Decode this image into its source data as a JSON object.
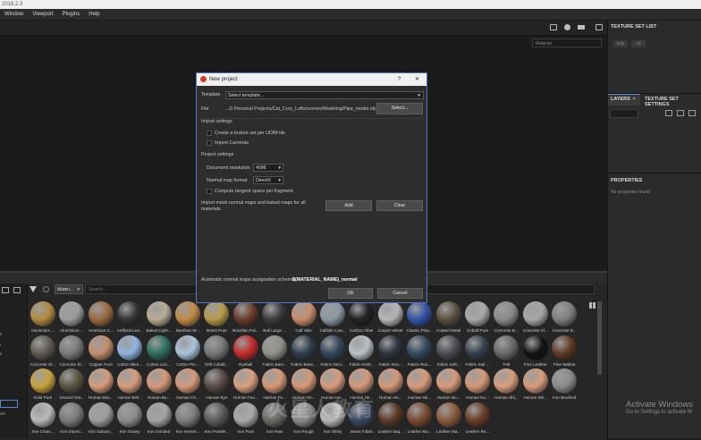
{
  "window": {
    "title": "2018.2.3"
  },
  "menu": [
    "Window",
    "Viewport",
    "Plugins",
    "Help"
  ],
  "viewport": {
    "display_channel": "Material"
  },
  "texture_set_list": {
    "title": "TEXTURE SET LIST",
    "buttons": [
      "Edit",
      "All"
    ]
  },
  "layers": {
    "tab_layers": "LAYERS",
    "tab_texture_settings": "TEXTURE SET SETTINGS",
    "close": "✕"
  },
  "properties": {
    "title": "PROPERTIES",
    "empty_text": "No properties found"
  },
  "shelf": {
    "filter_chip": "Materi...",
    "search_placeholder": "Search...",
    "side_items": [
      "s",
      "i",
      "s",
      "als"
    ],
    "materials": [
      {
        "label": "Aluminium ...",
        "color": "#b38a40"
      },
      {
        "label": "Aluminium ...",
        "color": "#9b9b9b"
      },
      {
        "label": "American C...",
        "color": "#9a6a3f"
      },
      {
        "label": "Artificial Lea...",
        "color": "#333333"
      },
      {
        "label": "Baked Light...",
        "color": "#b8ab94"
      },
      {
        "label": "Bamboo W...",
        "color": "#c28a43"
      },
      {
        "label": "Brass Pure",
        "color": "#b59b4b"
      },
      {
        "label": "Brazilian Pal...",
        "color": "#6a3c2a"
      },
      {
        "label": "Bull Large ...",
        "color": "#3b3b3b"
      },
      {
        "label": "Calf Skin",
        "color": "#c98c6a"
      },
      {
        "label": "Calfskin Lea...",
        "color": "#8a98a3"
      },
      {
        "label": "Carbon Fiber",
        "color": "#222222"
      },
      {
        "label": "Carpet Velvet",
        "color": "#b6b6b6"
      },
      {
        "label": "Classic Pinp...",
        "color": "#3453a8"
      },
      {
        "label": "Coated Metal",
        "color": "#5b5040"
      },
      {
        "label": "Cobalt Pure",
        "color": "#a8a8aa"
      },
      {
        "label": "Concrete B...",
        "color": "#8b8b8b"
      },
      {
        "label": "Concrete Cl...",
        "color": "#a7a7a7"
      },
      {
        "label": "Concrete D...",
        "color": "#7f7f7f"
      },
      {
        "label": "Concrete Sl...",
        "color": "#5f5a52"
      },
      {
        "label": "Concrete Sl...",
        "color": "#7a7a7a"
      },
      {
        "label": "Copper Pure",
        "color": "#c58c6e"
      },
      {
        "label": "Cotton Bien...",
        "color": "#8fb3df"
      },
      {
        "label": "Cotton Linc...",
        "color": "#2e6f5f"
      },
      {
        "label": "Cotton Pin...",
        "color": "#a9c4dd"
      },
      {
        "label": "Drill Cobalt...",
        "color": "#76777a"
      },
      {
        "label": "Eyeball",
        "color": "#c42a2a"
      },
      {
        "label": "Fabric Bam...",
        "color": "#8f8f8a"
      },
      {
        "label": "Fabric Base...",
        "color": "#2f3f4c"
      },
      {
        "label": "Fabric Deni...",
        "color": "#34465c"
      },
      {
        "label": "Fabric Knitt...",
        "color": "#b9c0c7"
      },
      {
        "label": "Fabric Rou...",
        "color": "#2d3440"
      },
      {
        "label": "Fabric Rou...",
        "color": "#324a5e"
      },
      {
        "label": "Fabric Soft...",
        "color": "#4a4d52"
      },
      {
        "label": "Fabric Suit ...",
        "color": "#34404e"
      },
      {
        "label": "Felt",
        "color": "#6a6a6a"
      },
      {
        "label": "Fine Leather",
        "color": "#121212"
      },
      {
        "label": "Fine Walnut",
        "color": "#5d3a24"
      },
      {
        "label": "Gold Pure",
        "color": "#c8a23c"
      },
      {
        "label": "Ground Gra...",
        "color": "#5b5440"
      },
      {
        "label": "Human Bac...",
        "color": "#d59a7a"
      },
      {
        "label": "Human Bell...",
        "color": "#d79c7c"
      },
      {
        "label": "Human Bu...",
        "color": "#d49878"
      },
      {
        "label": "Human Ch...",
        "color": "#d69a79"
      },
      {
        "label": "Human Eye",
        "color": "#5a4a48"
      },
      {
        "label": "Human Fac...",
        "color": "#d8a07f"
      },
      {
        "label": "Human Fe...",
        "color": "#d59877"
      },
      {
        "label": "Human He...",
        "color": "#d49776"
      },
      {
        "label": "Human He...",
        "color": "#d79b7a"
      },
      {
        "label": "Human He...",
        "color": "#d59a79"
      },
      {
        "label": "Human He...",
        "color": "#d49877"
      },
      {
        "label": "Human Ne...",
        "color": "#d79c7b"
      },
      {
        "label": "Human No...",
        "color": "#d69a79"
      },
      {
        "label": "Human No...",
        "color": "#d49876"
      },
      {
        "label": "Human Shi...",
        "color": "#d89d7c"
      },
      {
        "label": "Human Wri...",
        "color": "#d69b7a"
      },
      {
        "label": "Iron Brushed",
        "color": "#8a8a8a"
      },
      {
        "label": "Iron Chain...",
        "color": "#b9b9b9"
      },
      {
        "label": "Iron Diamo...",
        "color": "#7a7a7a"
      },
      {
        "label": "Iron Galvan...",
        "color": "#9c9ea0"
      },
      {
        "label": "Iron Grainy",
        "color": "#8b8c8e"
      },
      {
        "label": "Iron Grinded",
        "color": "#a3a4a6"
      },
      {
        "label": "Iron Hamm...",
        "color": "#7c7d7e"
      },
      {
        "label": "Iron Powde...",
        "color": "#5a5a5a"
      },
      {
        "label": "Iron Pure",
        "color": "#a9aaad"
      },
      {
        "label": "Iron Raw",
        "color": "#6c6a66"
      },
      {
        "label": "Iron Rough",
        "color": "#8a8a8a"
      },
      {
        "label": "Iron Shiny",
        "color": "#b8b9bb"
      },
      {
        "label": "Jeans Fabric",
        "color": "#3a4a63"
      },
      {
        "label": "Leather baq...",
        "color": "#5a3a26"
      },
      {
        "label": "Leather Ma...",
        "color": "#7a4a30"
      },
      {
        "label": "Leather Ma...",
        "color": "#8a5a3a"
      },
      {
        "label": "Leather Ro...",
        "color": "#6a3c26"
      }
    ]
  },
  "dialog": {
    "title": "New project",
    "help": "?",
    "close": "✕",
    "template_label": "Template",
    "template_value": "Select template...",
    "file_label": "File",
    "file_path": "...D Personal Projects/Cat_Cory_Lofts/scenes/Modeling/Pipe_model.obj",
    "select_button": "Select...",
    "import_settings": "Import settings",
    "texture_set_per_udim": "Create a texture set per UDIM tile",
    "import_cameras": "Import Cameras",
    "project_settings": "Project settings",
    "doc_res_label": "Document resolution",
    "doc_res_value": "4096",
    "normal_map_label": "Normal map format",
    "normal_map_value": "DirectX",
    "tangent_space": "Compute tangent space per fragment",
    "import_mesh_text": "Import mesh normal maps and baked maps for all materials.",
    "add_button": "Add",
    "clear_button": "Clear",
    "auto_scheme_label": "Automatic normal maps assignation scheme:",
    "auto_scheme_value": "$(MATERIAL_NAME)_normal",
    "ok_button": "OK",
    "cancel_button": "Cancel"
  },
  "watermark": {
    "title": "Activate Windows",
    "subtitle": "Go to Settings to activate W",
    "overlay": "火星人教育"
  }
}
